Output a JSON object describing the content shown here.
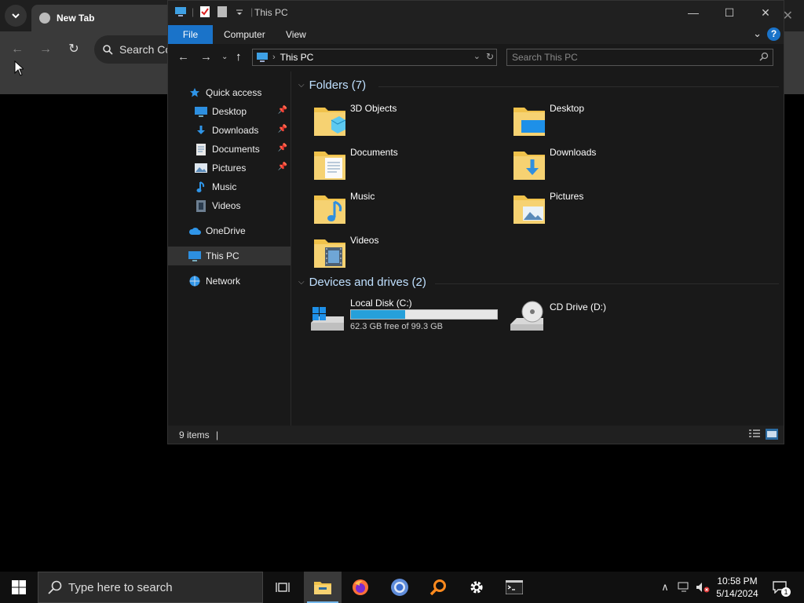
{
  "browser": {
    "tab_title": "New Tab",
    "omnibox_text": "Search Co"
  },
  "explorer": {
    "title": "This PC",
    "ribbon_tabs": [
      "File",
      "Computer",
      "View"
    ],
    "help": "?",
    "address": {
      "crumb": "This PC"
    },
    "search_placeholder": "Search This PC",
    "nav": {
      "quick_access": "Quick access",
      "desktop": "Desktop",
      "downloads": "Downloads",
      "documents": "Documents",
      "pictures": "Pictures",
      "music": "Music",
      "videos": "Videos",
      "onedrive": "OneDrive",
      "this_pc": "This PC",
      "network": "Network"
    },
    "folders_header": "Folders (7)",
    "folders": {
      "objects3d": "3D Objects",
      "desktop": "Desktop",
      "documents": "Documents",
      "downloads": "Downloads",
      "music": "Music",
      "pictures": "Pictures",
      "videos": "Videos"
    },
    "drives_header": "Devices and drives (2)",
    "drives": {
      "local_c": {
        "name": "Local Disk (C:)",
        "free_text": "62.3 GB free of 99.3 GB",
        "used_fraction": 0.373
      },
      "cd_d": {
        "name": "CD Drive (D:)"
      }
    },
    "status": "9 items"
  },
  "taskbar": {
    "search_placeholder": "Type here to search",
    "time": "10:58 PM",
    "date": "5/14/2024",
    "notification_count": "1"
  },
  "colors": {
    "accent": "#1a73c9",
    "folder_yellow": "#f0c24b",
    "drive_bar": "#26a0da",
    "group_header": "#bfe0ff"
  }
}
